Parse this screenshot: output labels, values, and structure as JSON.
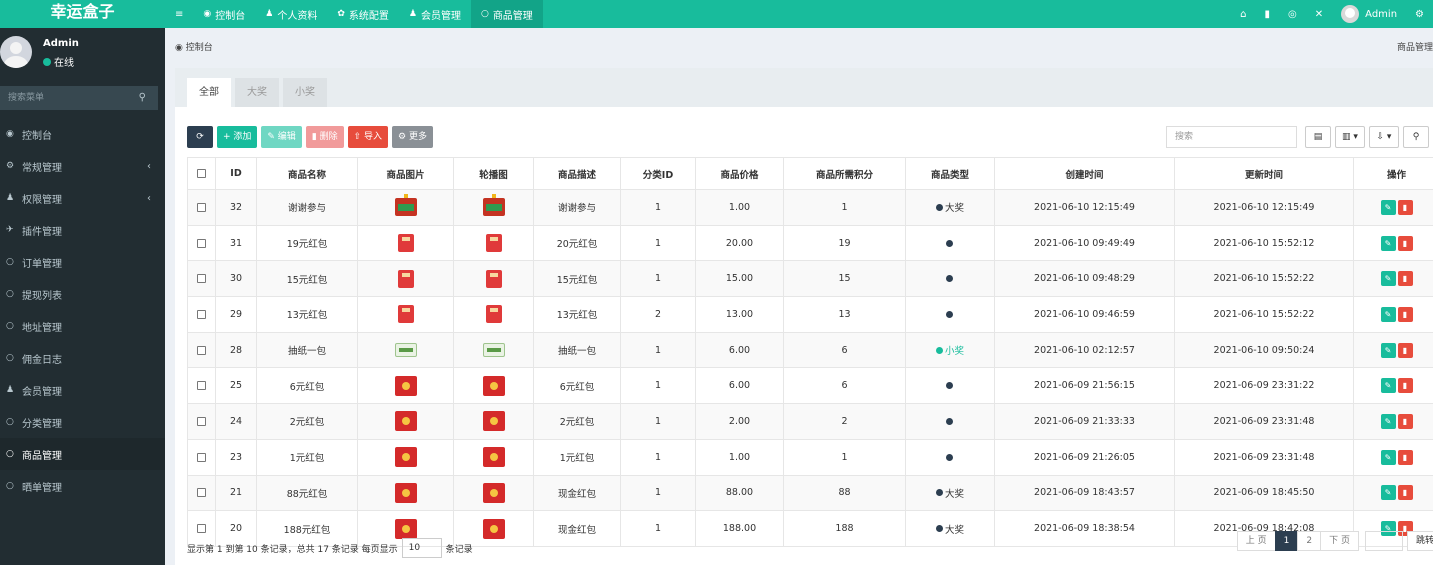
{
  "app": {
    "logo": "幸运盒子"
  },
  "topnav": {
    "menu_icon": "≡",
    "items": [
      {
        "icon": "dashboard-icon",
        "glyph": "◉",
        "label": "控制台"
      },
      {
        "icon": "user-icon",
        "glyph": "♟",
        "label": "个人资料"
      },
      {
        "icon": "gear-icon",
        "glyph": "✿",
        "label": "系统配置"
      },
      {
        "icon": "user-icon",
        "glyph": "♟",
        "label": "会员管理"
      },
      {
        "icon": "circle-icon",
        "glyph": "○",
        "label": "商品管理"
      }
    ],
    "right": {
      "home": "⌂",
      "trash": "▮",
      "refresh": "◎",
      "fullscreen": "✕",
      "admin": "Admin",
      "settings": "⚙"
    }
  },
  "sidebar": {
    "user": {
      "name": "Admin",
      "status": "在线"
    },
    "search_placeholder": "搜索菜单",
    "search_icon": "⚲",
    "items": [
      {
        "glyph": "◉",
        "icon": "dashboard-icon",
        "label": "控制台",
        "chevron": ""
      },
      {
        "glyph": "⚙",
        "icon": "cogs-icon",
        "label": "常规管理",
        "chevron": "‹"
      },
      {
        "glyph": "♟",
        "icon": "group-icon",
        "label": "权限管理",
        "chevron": "‹"
      },
      {
        "glyph": "✈",
        "icon": "rocket-icon",
        "label": "插件管理",
        "chevron": ""
      },
      {
        "glyph": "○",
        "icon": "circle-icon",
        "label": "订单管理",
        "chevron": ""
      },
      {
        "glyph": "○",
        "icon": "circle-icon",
        "label": "提现列表",
        "chevron": ""
      },
      {
        "glyph": "○",
        "icon": "circle-icon",
        "label": "地址管理",
        "chevron": ""
      },
      {
        "glyph": "○",
        "icon": "circle-icon",
        "label": "佣金日志",
        "chevron": ""
      },
      {
        "glyph": "♟",
        "icon": "user-icon",
        "label": "会员管理",
        "chevron": ""
      },
      {
        "glyph": "○",
        "icon": "circle-icon",
        "label": "分类管理",
        "chevron": ""
      },
      {
        "glyph": "○",
        "icon": "circle-icon",
        "label": "商品管理",
        "chevron": "",
        "active": true
      },
      {
        "glyph": "○",
        "icon": "circle-icon",
        "label": "晒单管理",
        "chevron": ""
      }
    ]
  },
  "breadcrumb": {
    "icon": "◉",
    "label": "控制台",
    "right": "商品管理"
  },
  "tabs": [
    "全部",
    "大奖",
    "小奖"
  ],
  "toolbar": {
    "refresh": "⟳",
    "add": "+ 添加",
    "edit": "✎ 编辑",
    "delete": "▮ 删除",
    "import": "⇧ 导入",
    "more": "⚙ 更多",
    "search_placeholder": "搜索",
    "toggle_view": "▤",
    "columns": "▥ ▾",
    "export": "⇩ ▾",
    "search_btn": "⚲"
  },
  "table": {
    "headers": [
      "ID",
      "商品名称",
      "商品图片",
      "轮播图",
      "商品描述",
      "分类ID",
      "商品价格",
      "商品所需积分",
      "商品类型",
      "创建时间",
      "更新时间",
      "操作"
    ],
    "rows": [
      {
        "id": "32",
        "name": "谢谢参与",
        "img": "thanks",
        "desc": "谢谢参与",
        "cat": "1",
        "price": "1.00",
        "points": "1",
        "type_dot": "dark",
        "type": "大奖",
        "created": "2021-06-10 12:15:49",
        "updated": "2021-06-10 12:15:49"
      },
      {
        "id": "31",
        "name": "19元红包",
        "img": "redbox",
        "desc": "20元红包",
        "cat": "1",
        "price": "20.00",
        "points": "19",
        "type_dot": "dark",
        "type": "",
        "created": "2021-06-10 09:49:49",
        "updated": "2021-06-10 15:52:12"
      },
      {
        "id": "30",
        "name": "15元红包",
        "img": "redbox",
        "desc": "15元红包",
        "cat": "1",
        "price": "15.00",
        "points": "15",
        "type_dot": "dark",
        "type": "",
        "created": "2021-06-10 09:48:29",
        "updated": "2021-06-10 15:52:22"
      },
      {
        "id": "29",
        "name": "13元红包",
        "img": "redbox",
        "desc": "13元红包",
        "cat": "2",
        "price": "13.00",
        "points": "13",
        "type_dot": "dark",
        "type": "",
        "created": "2021-06-10 09:46:59",
        "updated": "2021-06-10 15:52:22"
      },
      {
        "id": "28",
        "name": "抽纸一包",
        "img": "tissue",
        "desc": "抽纸一包",
        "cat": "1",
        "price": "6.00",
        "points": "6",
        "type_dot": "green",
        "type": "小奖",
        "created": "2021-06-10 02:12:57",
        "updated": "2021-06-10 09:50:24"
      },
      {
        "id": "25",
        "name": "6元红包",
        "img": "env",
        "desc": "6元红包",
        "cat": "1",
        "price": "6.00",
        "points": "6",
        "type_dot": "dark",
        "type": "",
        "created": "2021-06-09 21:56:15",
        "updated": "2021-06-09 23:31:22"
      },
      {
        "id": "24",
        "name": "2元红包",
        "img": "env",
        "desc": "2元红包",
        "cat": "1",
        "price": "2.00",
        "points": "2",
        "type_dot": "dark",
        "type": "",
        "created": "2021-06-09 21:33:33",
        "updated": "2021-06-09 23:31:48"
      },
      {
        "id": "23",
        "name": "1元红包",
        "img": "env",
        "desc": "1元红包",
        "cat": "1",
        "price": "1.00",
        "points": "1",
        "type_dot": "dark",
        "type": "",
        "created": "2021-06-09 21:26:05",
        "updated": "2021-06-09 23:31:48"
      },
      {
        "id": "21",
        "name": "88元红包",
        "img": "env",
        "desc": "现金红包",
        "cat": "1",
        "price": "88.00",
        "points": "88",
        "type_dot": "dark",
        "type": "大奖",
        "created": "2021-06-09 18:43:57",
        "updated": "2021-06-09 18:45:50"
      },
      {
        "id": "20",
        "name": "188元红包",
        "img": "env",
        "desc": "现金红包",
        "cat": "1",
        "price": "188.00",
        "points": "188",
        "type_dot": "dark",
        "type": "大奖",
        "created": "2021-06-09 18:38:54",
        "updated": "2021-06-09 18:42:08"
      }
    ],
    "edit_glyph": "✎",
    "delete_glyph": "▮"
  },
  "footer": {
    "info_pre": "显示第 1 到第 10 条记录，总共 17 条记录 每页显示",
    "page_size": "10",
    "info_post": "条记录",
    "pager": [
      "上 页",
      "1",
      "2",
      "下 页"
    ],
    "jump": "跳转"
  },
  "colors": {
    "brand": "#18bc9c",
    "sidebar": "#222d32",
    "danger": "#e74c3c",
    "dark": "#2c3e50"
  }
}
